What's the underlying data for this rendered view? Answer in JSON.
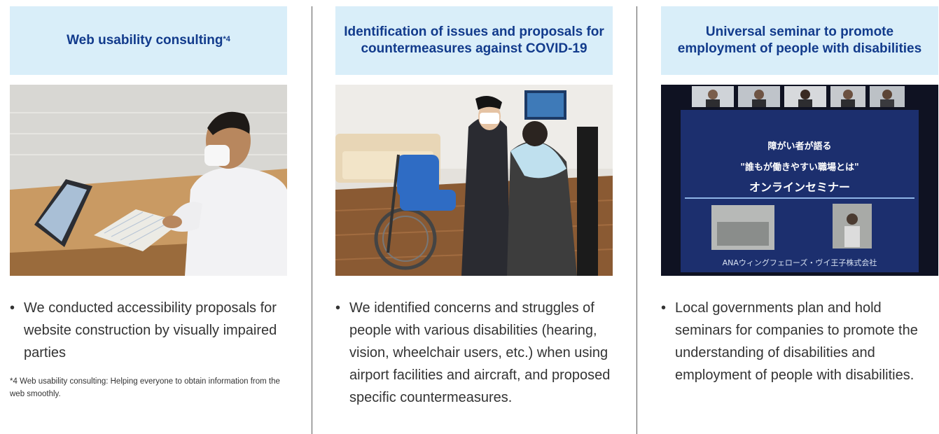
{
  "columns": [
    {
      "title": "Web usability consulting",
      "title_sup": "*4",
      "bullet": "We conducted accessibility propos­als for website construction by visually impaired parties",
      "footnote_mark": "*4",
      "footnote": "Web usability consulting: Helping everyone to obtain information from the web smoothly."
    },
    {
      "title": "Identification of issues and propos­als for countermeasures against COVID-19",
      "bullet": "We identified concerns and strug­gles of people with various disabili­ties (hearing, vision, wheelchair users, etc.) when using airport facilities and aircraft, and proposed specific countermeasures."
    },
    {
      "title": "Universal seminar to promote employment of people with disabilities",
      "bullet": "Local governments plan and hold seminars for companies to promote the understanding of disabilities and employment of people with disabilities.",
      "slide": {
        "line1": "障がい者が語る",
        "line2": "\"誰もが働きやすい職場とは\"",
        "line3": "オンラインセミナー",
        "company": "ANAウィングフェローズ・ヴイ王子株式会社"
      }
    }
  ],
  "bullet_symbol": "•"
}
